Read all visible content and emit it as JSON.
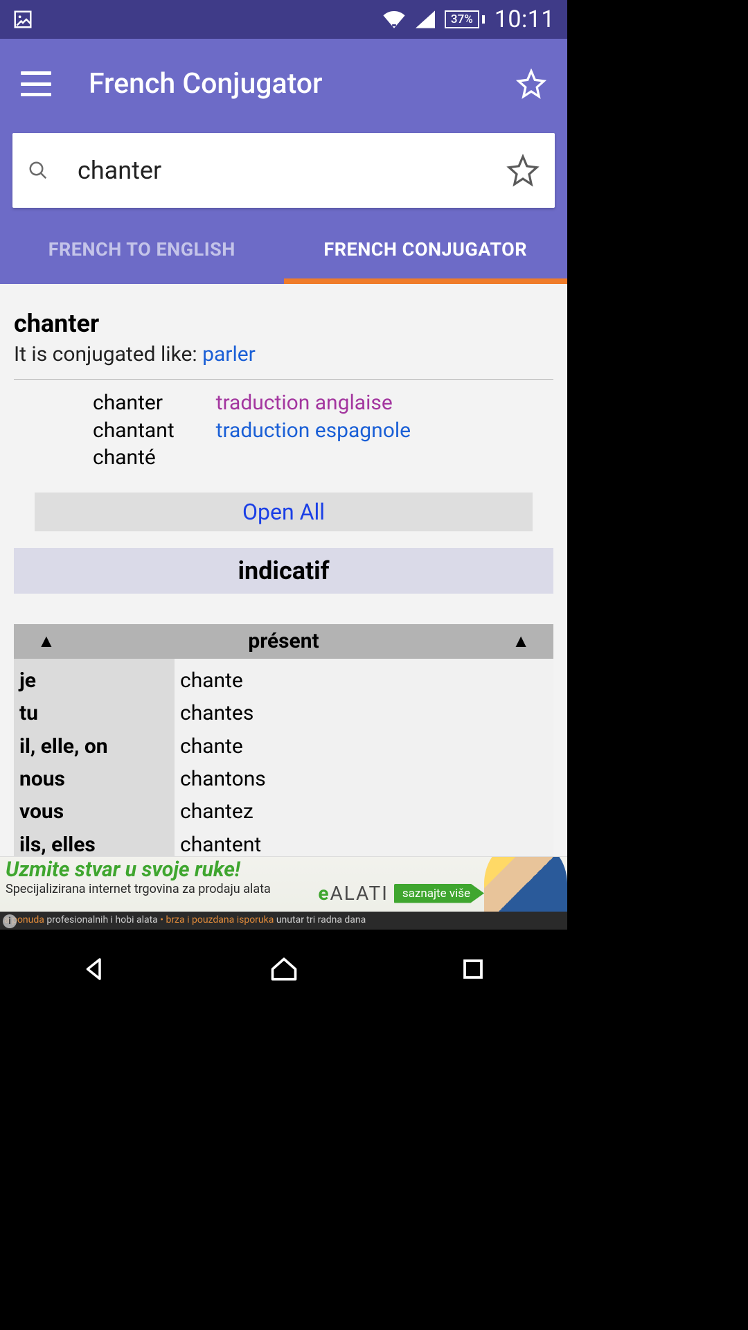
{
  "status": {
    "battery": "37%",
    "time": "10:11"
  },
  "header": {
    "title": "French Conjugator"
  },
  "search": {
    "value": "chanter"
  },
  "tabs": {
    "t1": "FRENCH TO ENGLISH",
    "t2": "FRENCH CONJUGATOR"
  },
  "verb": {
    "title": "chanter",
    "conj_like_prefix": "It is conjugated like: ",
    "conj_like_link": "parler",
    "forms": {
      "infinitive": "chanter",
      "present_participle": "chantant",
      "past_participle": "chanté"
    },
    "translations": {
      "english": "traduction anglaise",
      "spanish": "traduction espagnole"
    },
    "open_all": "Open All",
    "mood": "indicatif",
    "tense": "présent",
    "pronouns": [
      "je",
      "tu",
      "il, elle, on",
      "nous",
      "vous",
      "ils, elles"
    ],
    "values": [
      "chante",
      "chantes",
      "chante",
      "chantons",
      "chantez",
      "chantent"
    ]
  },
  "ad": {
    "title": "Uzmite stvar u svoje ruke!",
    "subtitle": "Specijalizirana internet trgovina za prodaju alata",
    "logo_prefix": "e",
    "logo_text": "ALATI",
    "cta": "saznajte više",
    "strip_a": "a ponuda ",
    "strip_b": "profesionalnih i hobi alata",
    "strip_sep": " • ",
    "strip_c": "brza i pouzdana isporuka",
    "strip_d": " unutar tri radna dana"
  }
}
